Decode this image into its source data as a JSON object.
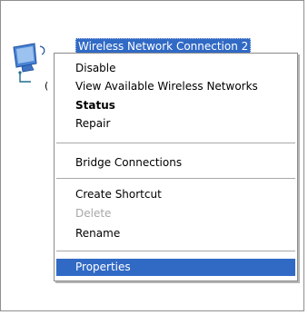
{
  "connection": {
    "name": "Wireless Network Connection 2",
    "clipped_status_char": "("
  },
  "context_menu": {
    "items": [
      {
        "label": "Disable"
      },
      {
        "label": "View Available Wireless Networks"
      },
      {
        "label": "Status"
      },
      {
        "label": "Repair"
      },
      {
        "label": "Bridge Connections"
      },
      {
        "label": "Create Shortcut"
      },
      {
        "label": "Delete"
      },
      {
        "label": "Rename"
      },
      {
        "label": "Properties"
      }
    ]
  },
  "icons": {
    "connection": "wireless-network-connection-icon"
  },
  "colors": {
    "selection": "#316ac5",
    "disabled_text": "#a8a8a8"
  }
}
